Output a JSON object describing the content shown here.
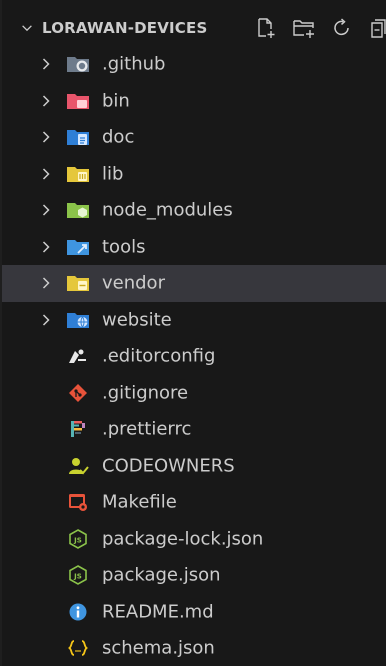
{
  "explorer": {
    "section_title": "LORAWAN-DEVICES",
    "actions": [
      {
        "name": "new-file-icon"
      },
      {
        "name": "new-folder-icon"
      },
      {
        "name": "refresh-icon"
      },
      {
        "name": "collapse-all-icon"
      }
    ]
  },
  "tree": {
    "folders": [
      {
        "label": ".github",
        "icon": "github-folder-icon",
        "color": "#6e7b8b"
      },
      {
        "label": "bin",
        "icon": "bin-folder-icon",
        "color": "#e8556b"
      },
      {
        "label": "doc",
        "icon": "doc-folder-icon",
        "color": "#3f8fe0"
      },
      {
        "label": "lib",
        "icon": "lib-folder-icon",
        "color": "#e5c73b"
      },
      {
        "label": "node_modules",
        "icon": "node-modules-folder-icon",
        "color": "#8bc34a"
      },
      {
        "label": "tools",
        "icon": "tools-folder-icon",
        "color": "#4ea3e6"
      },
      {
        "label": "vendor",
        "icon": "vendor-folder-icon",
        "color": "#e5c73b"
      },
      {
        "label": "website",
        "icon": "website-folder-icon",
        "color": "#3f8fe0"
      }
    ],
    "files": [
      {
        "label": ".editorconfig",
        "icon": "editorconfig-icon"
      },
      {
        "label": ".gitignore",
        "icon": "git-icon"
      },
      {
        "label": ".prettierrc",
        "icon": "prettier-icon"
      },
      {
        "label": "CODEOWNERS",
        "icon": "codeowners-icon"
      },
      {
        "label": "Makefile",
        "icon": "makefile-icon"
      },
      {
        "label": "package-lock.json",
        "icon": "nodejs-icon"
      },
      {
        "label": "package.json",
        "icon": "nodejs-icon"
      },
      {
        "label": "README.md",
        "icon": "info-icon"
      },
      {
        "label": "schema.json",
        "icon": "json-icon"
      }
    ],
    "selected": "vendor"
  }
}
